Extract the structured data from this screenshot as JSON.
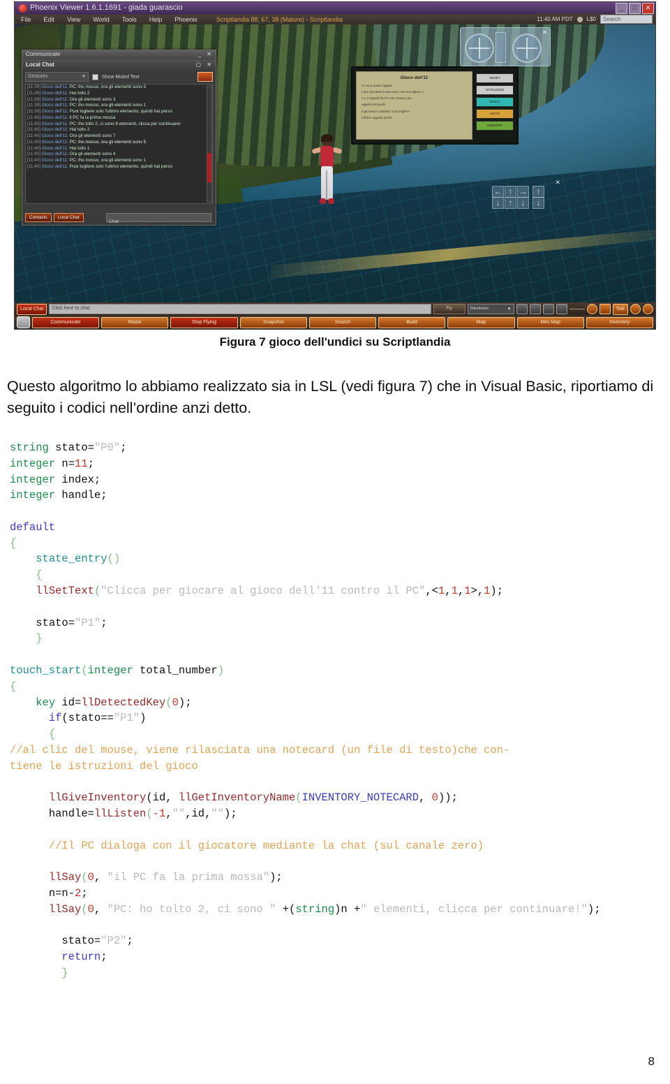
{
  "document": {
    "caption": "Figura 7 gioco dell'undici su Scriptlandia",
    "paragraph": "Questo algoritmo lo abbiamo realizzato sia in LSL (vedi figura 7) che in Visual Basic, riportiamo di seguito i codici nell’ordine anzi detto.",
    "page_number": "8"
  },
  "viewer": {
    "title": "Phoenix Viewer 1.6.1.1691 - giada guarascio",
    "window_buttons": {
      "minimize": "_",
      "maximize": "□",
      "close": "✕"
    },
    "menu": [
      "File",
      "Edit",
      "View",
      "World",
      "Tools",
      "Help",
      "Phoenix"
    ],
    "location": "Scriptlandia 88, 67, 38 (Mature) - Scriptlandia",
    "status": {
      "time": "11:40 AM PDT",
      "balance": "L$0",
      "search_placeholder": "Search"
    }
  },
  "chat_window": {
    "window_title": "Communicate",
    "panel_title": "Local Chat",
    "gestures_label": "Gestures",
    "show_muted_label": "Show Muted Text",
    "entry_placeholder": "Chat",
    "tabs": [
      "Contacts",
      "Local Chat"
    ],
    "lines": [
      {
        "ts": "[11:39]",
        "who": "Gioco dell'11",
        "msg": "PC: lho mosso, ora gli elementi sono 5"
      },
      {
        "ts": "[11:39]",
        "who": "Gioco dell'11",
        "msg": "Hai tolto 2"
      },
      {
        "ts": "[11:39]",
        "who": "Gioco dell'11",
        "msg": "Ora gli elementi sono 3"
      },
      {
        "ts": "[11:39]",
        "who": "Gioco dell'11",
        "msg": "PC: lho mosso, ora gli elementi sono 1"
      },
      {
        "ts": "[11:39]",
        "who": "Gioco dell'11",
        "msg": "Puoi togliere solo l'ultimo elemento, quindi hai perso"
      },
      {
        "ts": "[11:40]",
        "who": "Gioco dell'11",
        "msg": "il PC fa la prima mossa"
      },
      {
        "ts": "[11:40]",
        "who": "Gioco dell'11",
        "msg": "PC: lho tolto 2, ci sono 9 elementi, clicca per continuare!"
      },
      {
        "ts": "[11:40]",
        "who": "Gioco dell'11",
        "msg": "Hai tolto 2"
      },
      {
        "ts": "[11:40]",
        "who": "Gioco dell'11",
        "msg": "Ora gli elementi sono 7"
      },
      {
        "ts": "[11:40]",
        "who": "Gioco dell'11",
        "msg": "PC: lho mosso, ora gli elementi sono 5"
      },
      {
        "ts": "[11:40]",
        "who": "Gioco dell'11",
        "msg": "Hai tolto 1"
      },
      {
        "ts": "[11:40]",
        "who": "Gioco dell'11",
        "msg": "Ora gli elementi sono 4"
      },
      {
        "ts": "[11:40]",
        "who": "Gioco dell'11",
        "msg": "PC: lho mosso, ora gli elementi sono 1"
      },
      {
        "ts": "[11:40]",
        "who": "Gioco dell'11",
        "msg": "Puoi togliere solo l'ultimo elemento, quindi hai perso"
      }
    ]
  },
  "notecard_panel": {
    "title": "Gioco dell'11",
    "rules": [
      "Ci sono undici oggetti",
      "I due giocatori si alternano nel raccogliere 1,",
      "2 o 3 oggetti finche non restano piu",
      "oggetti sul tavolo",
      "Il giocatore costretto a raccogliere",
      "l'ultimo oggetto perde"
    ],
    "buttons": [
      "RESET",
      "ISTRUZIONI",
      "GIOCA",
      "AIUTO",
      "INDIETRO"
    ]
  },
  "bottom_bar": {
    "local_chat_label": "Local Chat",
    "chat_placeholder": "Click here to chat",
    "fly_label": "Fly",
    "gestures_label": "Gestures",
    "talk_label": "Talk",
    "buttons": [
      "Communicate",
      "Radar",
      "Stop Flying",
      "Snapshot",
      "Search",
      "Build",
      "Map",
      "Mini Map",
      "Inventory"
    ]
  },
  "hud": {
    "camera_close": "✕",
    "move_close": "✕",
    "arrows": [
      "←",
      "↑",
      "→",
      "↑",
      "↓",
      "↓",
      "↑",
      "↓"
    ]
  },
  "code_lines": [
    [
      {
        "t": "string",
        "c": "ty"
      },
      {
        "t": " stato=",
        "c": "pl"
      },
      {
        "t": "\"P0\"",
        "c": "st"
      },
      {
        "t": ";",
        "c": "pl"
      }
    ],
    [
      {
        "t": "integer",
        "c": "ty"
      },
      {
        "t": " n=",
        "c": "pl"
      },
      {
        "t": "11",
        "c": "nu"
      },
      {
        "t": ";",
        "c": "pl"
      }
    ],
    [
      {
        "t": "integer",
        "c": "ty"
      },
      {
        "t": " index;",
        "c": "pl"
      }
    ],
    [
      {
        "t": "integer",
        "c": "ty"
      },
      {
        "t": " handle;",
        "c": "pl"
      }
    ],
    [
      {
        "t": "",
        "c": "pl"
      }
    ],
    [
      {
        "t": "default",
        "c": "kw"
      }
    ],
    [
      {
        "t": "{",
        "c": "br"
      }
    ],
    [
      {
        "t": "    ",
        "c": "pl"
      },
      {
        "t": "state_entry",
        "c": "ev"
      },
      {
        "t": "()",
        "c": "br"
      }
    ],
    [
      {
        "t": "    {",
        "c": "br"
      }
    ],
    [
      {
        "t": "    ",
        "c": "pl"
      },
      {
        "t": "llSetText",
        "c": "fn"
      },
      {
        "t": "(",
        "c": "br"
      },
      {
        "t": "\"Clicca per giocare al gioco dell'11 contro il PC\"",
        "c": "st"
      },
      {
        "t": ",<",
        "c": "pl"
      },
      {
        "t": "1",
        "c": "nu"
      },
      {
        "t": ",",
        "c": "pl"
      },
      {
        "t": "1",
        "c": "nu"
      },
      {
        "t": ",",
        "c": "pl"
      },
      {
        "t": "1",
        "c": "nu"
      },
      {
        "t": ">,",
        "c": "pl"
      },
      {
        "t": "1",
        "c": "nu"
      },
      {
        "t": ");",
        "c": "pl"
      }
    ],
    [
      {
        "t": "",
        "c": "pl"
      }
    ],
    [
      {
        "t": "    stato=",
        "c": "pl"
      },
      {
        "t": "\"P1\"",
        "c": "st"
      },
      {
        "t": ";",
        "c": "pl"
      }
    ],
    [
      {
        "t": "    }",
        "c": "br"
      }
    ],
    [
      {
        "t": "",
        "c": "pl"
      }
    ],
    [
      {
        "t": "touch_start",
        "c": "ev"
      },
      {
        "t": "(",
        "c": "br"
      },
      {
        "t": "integer",
        "c": "ty"
      },
      {
        "t": " total_number",
        "c": "pl"
      },
      {
        "t": ")",
        "c": "br"
      }
    ],
    [
      {
        "t": "{",
        "c": "br"
      }
    ],
    [
      {
        "t": "    ",
        "c": "pl"
      },
      {
        "t": "key",
        "c": "ty"
      },
      {
        "t": " id=",
        "c": "pl"
      },
      {
        "t": "llDetectedKey",
        "c": "fn"
      },
      {
        "t": "(",
        "c": "br"
      },
      {
        "t": "0",
        "c": "nu"
      },
      {
        "t": ");",
        "c": "pl"
      }
    ],
    [
      {
        "t": "      ",
        "c": "pl"
      },
      {
        "t": "if",
        "c": "kw"
      },
      {
        "t": "(stato==",
        "c": "pl"
      },
      {
        "t": "\"P1\"",
        "c": "st"
      },
      {
        "t": ")",
        "c": "pl"
      }
    ],
    [
      {
        "t": "      {",
        "c": "br"
      }
    ],
    [
      {
        "t": "//al clic del mouse, viene rilasciata una notecard (un file di testo)che con-",
        "c": "cm"
      }
    ],
    [
      {
        "t": "tiene le istruzioni del gioco",
        "c": "cm"
      }
    ],
    [
      {
        "t": "",
        "c": "pl"
      }
    ],
    [
      {
        "t": "      ",
        "c": "pl"
      },
      {
        "t": "llGiveInventory",
        "c": "fn"
      },
      {
        "t": "(id, ",
        "c": "pl"
      },
      {
        "t": "llGetInventoryName",
        "c": "fn"
      },
      {
        "t": "(",
        "c": "br"
      },
      {
        "t": "INVENTORY_NOTECARD",
        "c": "cn"
      },
      {
        "t": ", ",
        "c": "pl"
      },
      {
        "t": "0",
        "c": "nu"
      },
      {
        "t": "));",
        "c": "pl"
      }
    ],
    [
      {
        "t": "      handle=",
        "c": "pl"
      },
      {
        "t": "llListen",
        "c": "fn"
      },
      {
        "t": "(",
        "c": "br"
      },
      {
        "t": "-1",
        "c": "nu"
      },
      {
        "t": ",",
        "c": "pl"
      },
      {
        "t": "\"\"",
        "c": "st"
      },
      {
        "t": ",id,",
        "c": "pl"
      },
      {
        "t": "\"\"",
        "c": "st"
      },
      {
        "t": ");",
        "c": "pl"
      }
    ],
    [
      {
        "t": "",
        "c": "pl"
      }
    ],
    [
      {
        "t": "      ",
        "c": "pl"
      },
      {
        "t": "//Il PC dialoga con il giocatore mediante la chat (sul canale zero)",
        "c": "cm"
      }
    ],
    [
      {
        "t": "",
        "c": "pl"
      }
    ],
    [
      {
        "t": "      ",
        "c": "pl"
      },
      {
        "t": "llSay",
        "c": "fn"
      },
      {
        "t": "(",
        "c": "br"
      },
      {
        "t": "0",
        "c": "nu"
      },
      {
        "t": ", ",
        "c": "pl"
      },
      {
        "t": "\"il PC fa la prima mossa\"",
        "c": "st"
      },
      {
        "t": ");",
        "c": "pl"
      }
    ],
    [
      {
        "t": "      n=n-",
        "c": "pl"
      },
      {
        "t": "2",
        "c": "nu"
      },
      {
        "t": ";",
        "c": "pl"
      }
    ],
    [
      {
        "t": "      ",
        "c": "pl"
      },
      {
        "t": "llSay",
        "c": "fn"
      },
      {
        "t": "(",
        "c": "br"
      },
      {
        "t": "0",
        "c": "nu"
      },
      {
        "t": ", ",
        "c": "pl"
      },
      {
        "t": "\"PC: ho tolto 2, ci sono \"",
        "c": "st"
      },
      {
        "t": " +(",
        "c": "pl"
      },
      {
        "t": "string",
        "c": "ty"
      },
      {
        "t": ")n +",
        "c": "pl"
      },
      {
        "t": "\" elementi, clicca per continuare!\"",
        "c": "st"
      },
      {
        "t": ");",
        "c": "pl"
      }
    ],
    [
      {
        "t": "",
        "c": "pl"
      }
    ],
    [
      {
        "t": "        stato=",
        "c": "pl"
      },
      {
        "t": "\"P2\"",
        "c": "st"
      },
      {
        "t": ";",
        "c": "pl"
      }
    ],
    [
      {
        "t": "        ",
        "c": "pl"
      },
      {
        "t": "return",
        "c": "kw"
      },
      {
        "t": ";",
        "c": "pl"
      }
    ],
    [
      {
        "t": "        }",
        "c": "br"
      }
    ]
  ]
}
